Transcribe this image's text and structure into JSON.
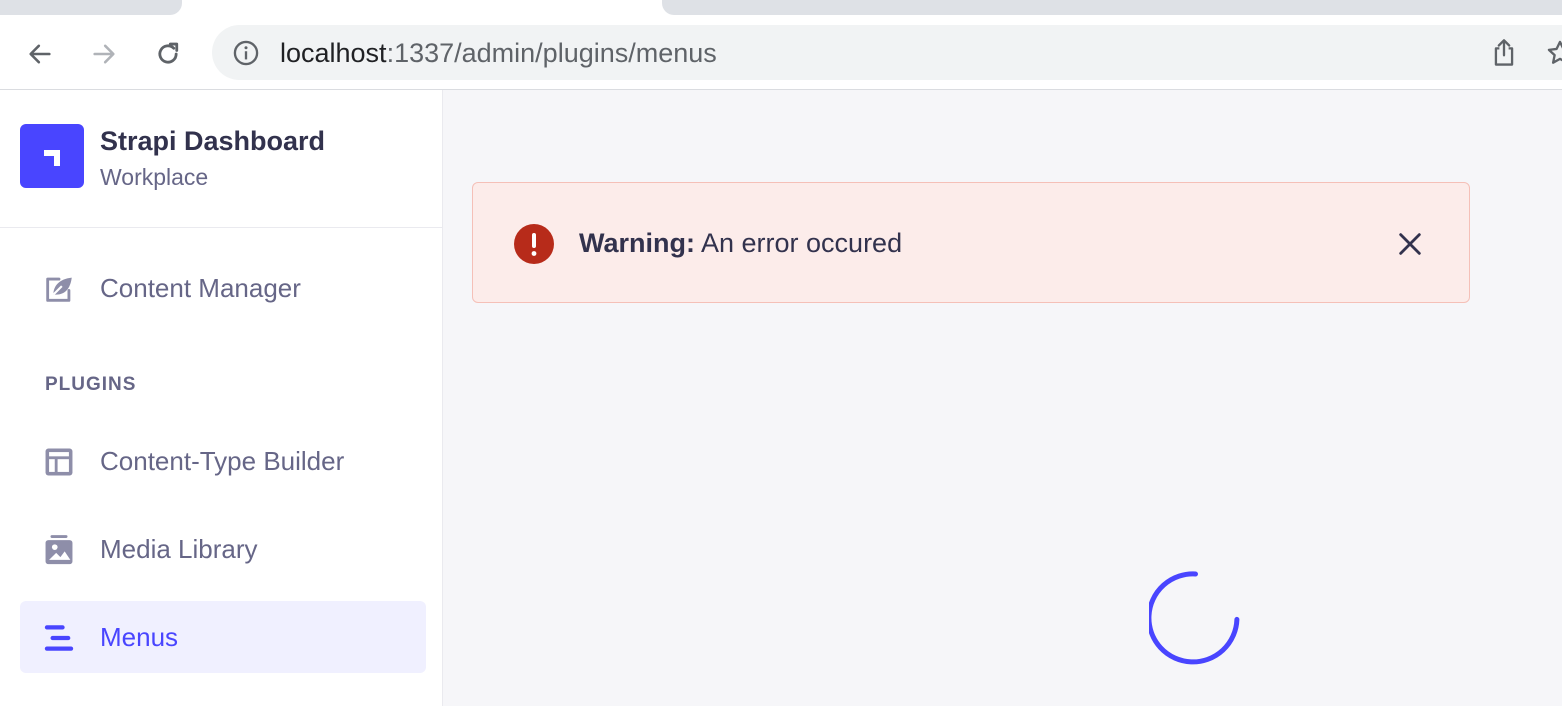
{
  "browser": {
    "url_host": "localhost",
    "url_path": ":1337/admin/plugins/menus"
  },
  "sidebar": {
    "brand_title": "Strapi Dashboard",
    "brand_subtitle": "Workplace",
    "items": [
      {
        "label": "Content Manager",
        "icon": "feather-icon"
      }
    ],
    "section_label": "PLUGINS",
    "plugin_items": [
      {
        "label": "Content-Type Builder",
        "icon": "layout-icon"
      },
      {
        "label": "Media Library",
        "icon": "image-icon"
      },
      {
        "label": "Menus",
        "icon": "menu-lines-icon",
        "active": true
      }
    ]
  },
  "alert": {
    "title": "Warning:",
    "message": "An error occured",
    "icon": "exclamation-icon",
    "color": "#b72b1a"
  },
  "colors": {
    "accent": "#4945ff",
    "alert_bg": "#fcecea",
    "alert_border": "#f5c0b8"
  }
}
